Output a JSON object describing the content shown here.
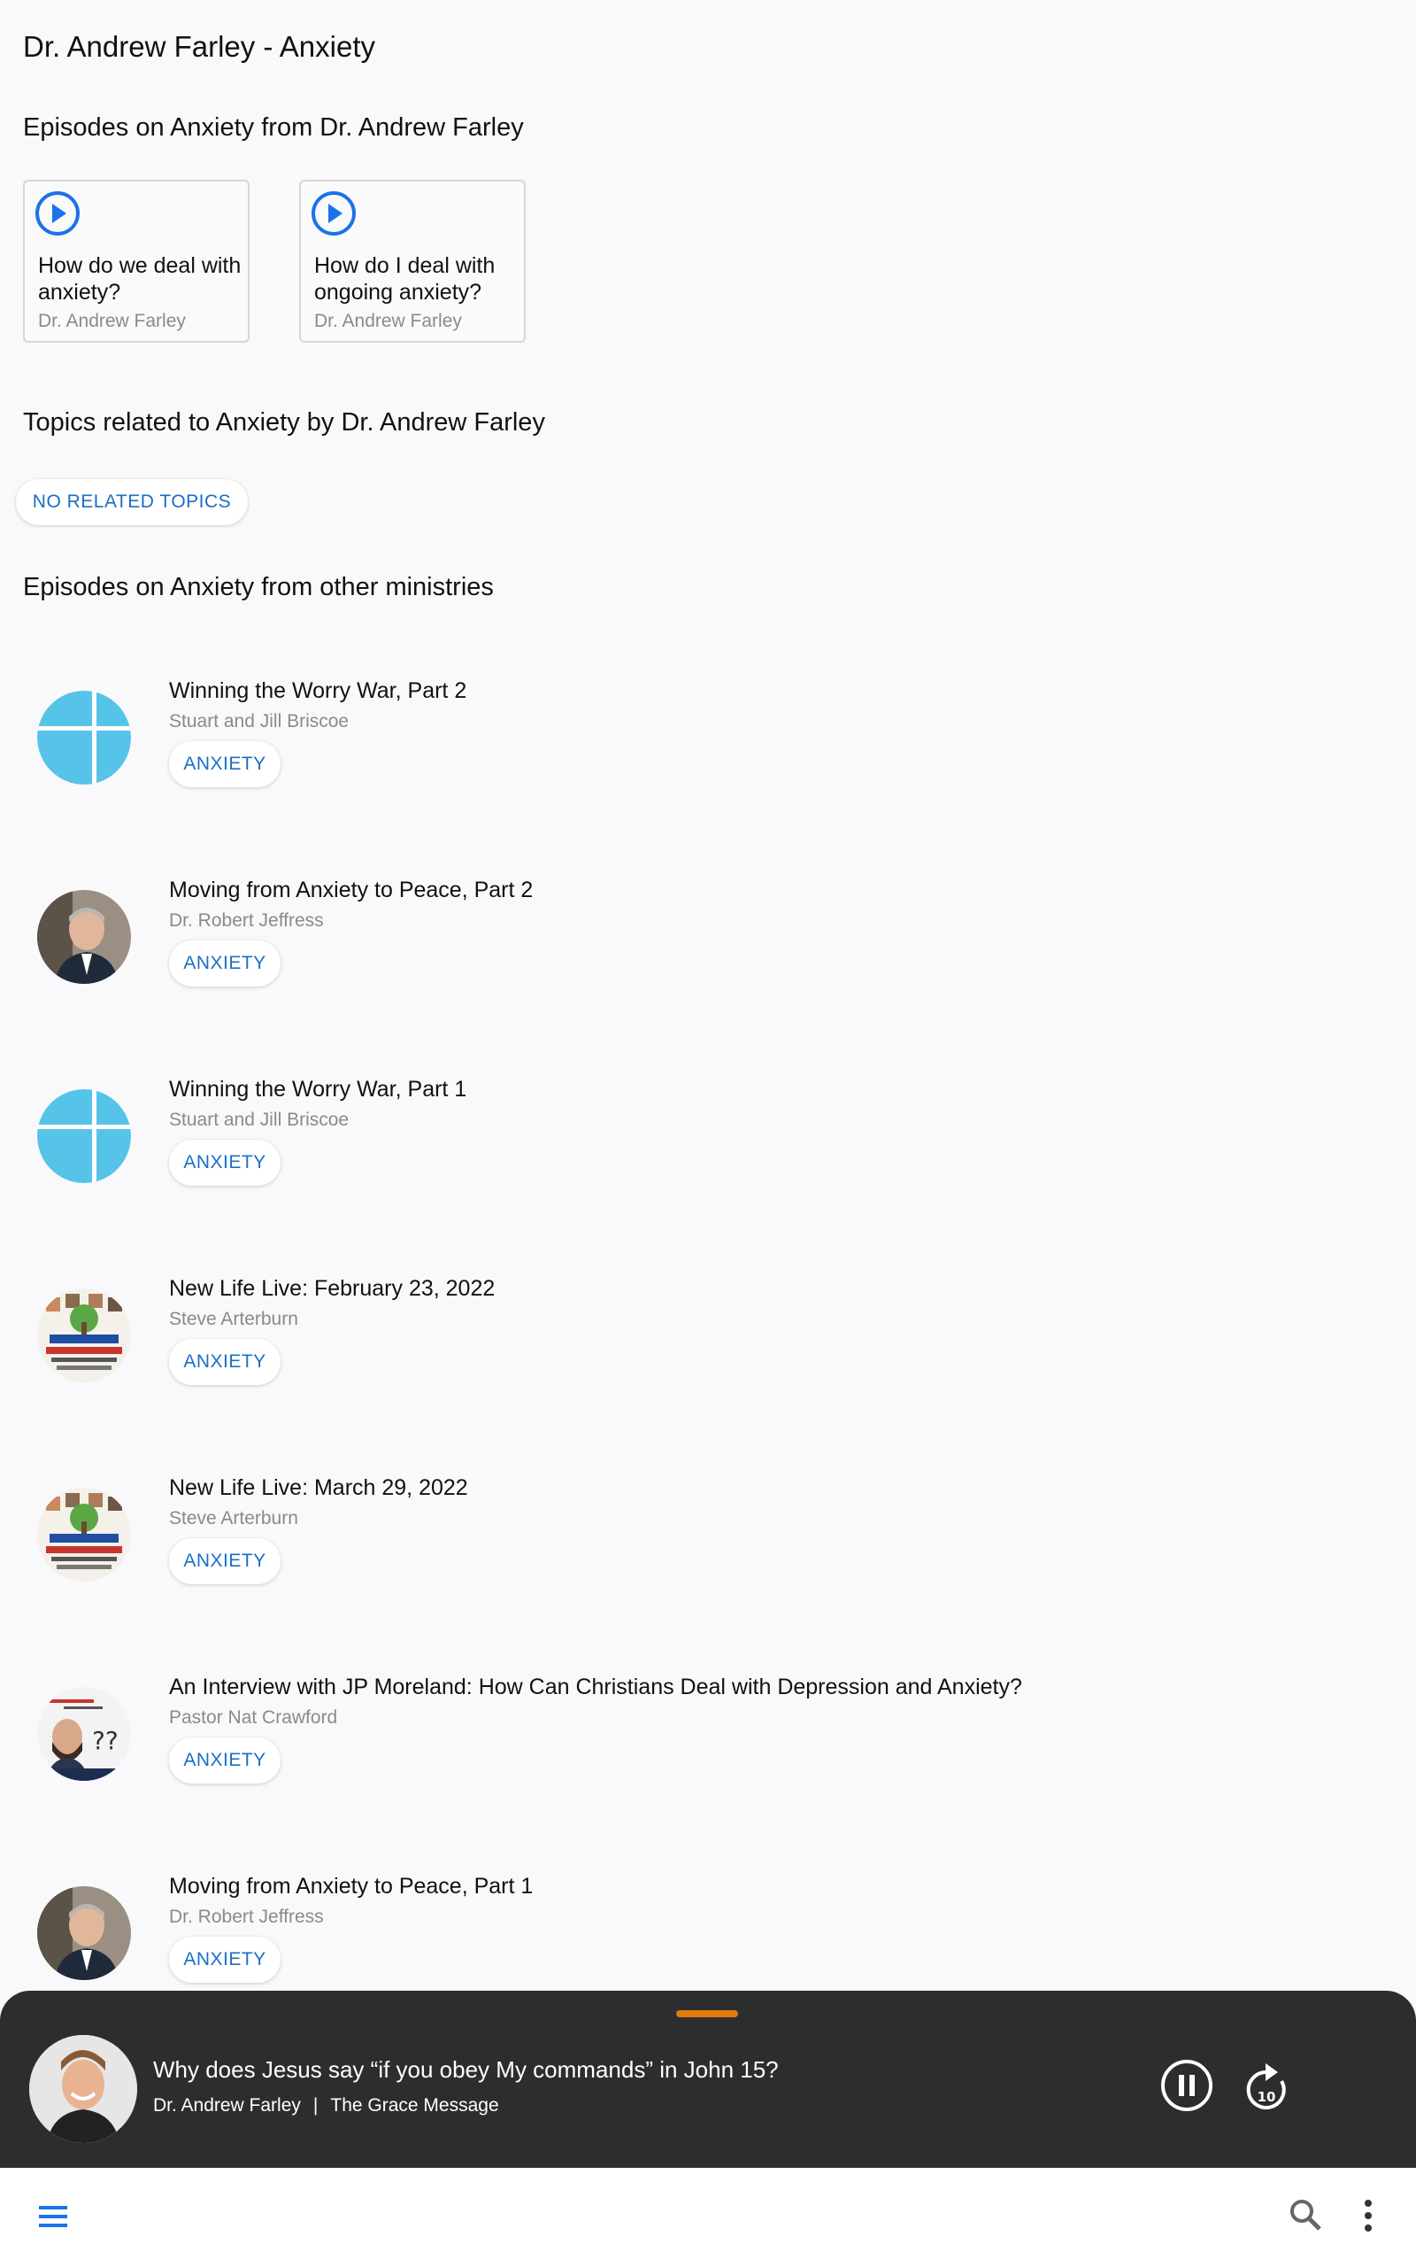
{
  "page": {
    "title": "Dr. Andrew Farley - Anxiety"
  },
  "sections": {
    "episodes_from_speaker": "Episodes on Anxiety from Dr. Andrew Farley",
    "related_topics": "Topics related to Anxiety by Dr. Andrew Farley",
    "other_ministries": "Episodes on Anxiety from other ministries"
  },
  "speaker_episodes": [
    {
      "title": "How do we deal with anxiety?",
      "author": "Dr. Andrew Farley"
    },
    {
      "title": "How do I deal with ongoing anxiety?",
      "author": "Dr. Andrew Farley"
    }
  ],
  "related_topics_label": "NO RELATED TOPICS",
  "other_episodes": [
    {
      "title": "Winning the Worry War, Part 2",
      "author": "Stuart and Jill Briscoe",
      "tag": "ANXIETY",
      "thumb": "cross-logo"
    },
    {
      "title": "Moving from Anxiety to Peace, Part 2",
      "author": "Dr. Robert Jeffress",
      "tag": "ANXIETY",
      "thumb": "speaker-portrait"
    },
    {
      "title": "Winning the Worry War, Part 1",
      "author": "Stuart and Jill Briscoe",
      "tag": "ANXIETY",
      "thumb": "cross-logo"
    },
    {
      "title": "New Life Live: February 23, 2022",
      "author": "Steve Arterburn",
      "tag": "ANXIETY",
      "thumb": "newlife-logo"
    },
    {
      "title": "New Life Live: March 29, 2022",
      "author": "Steve Arterburn",
      "tag": "ANXIETY",
      "thumb": "newlife-logo"
    },
    {
      "title": "An Interview with JP Moreland:  How Can Christians Deal with Depression and Anxiety?",
      "author": "Pastor Nat Crawford",
      "tag": "ANXIETY",
      "thumb": "hard-questions-logo"
    },
    {
      "title": "Moving from Anxiety to Peace, Part 1",
      "author": "Dr. Robert Jeffress",
      "tag": "ANXIETY",
      "thumb": "speaker-portrait"
    }
  ],
  "player": {
    "title": "Why does Jesus say “if you obey My commands” in John 15?",
    "author": "Dr. Andrew Farley",
    "separator": "|",
    "program": "The Grace Message",
    "skip_label": "10",
    "handle_color": "#e37a0d"
  },
  "colors": {
    "accent": "#1a6fc4",
    "player_bg": "#2c2d2f",
    "cross_logo": "#55c4e8"
  }
}
